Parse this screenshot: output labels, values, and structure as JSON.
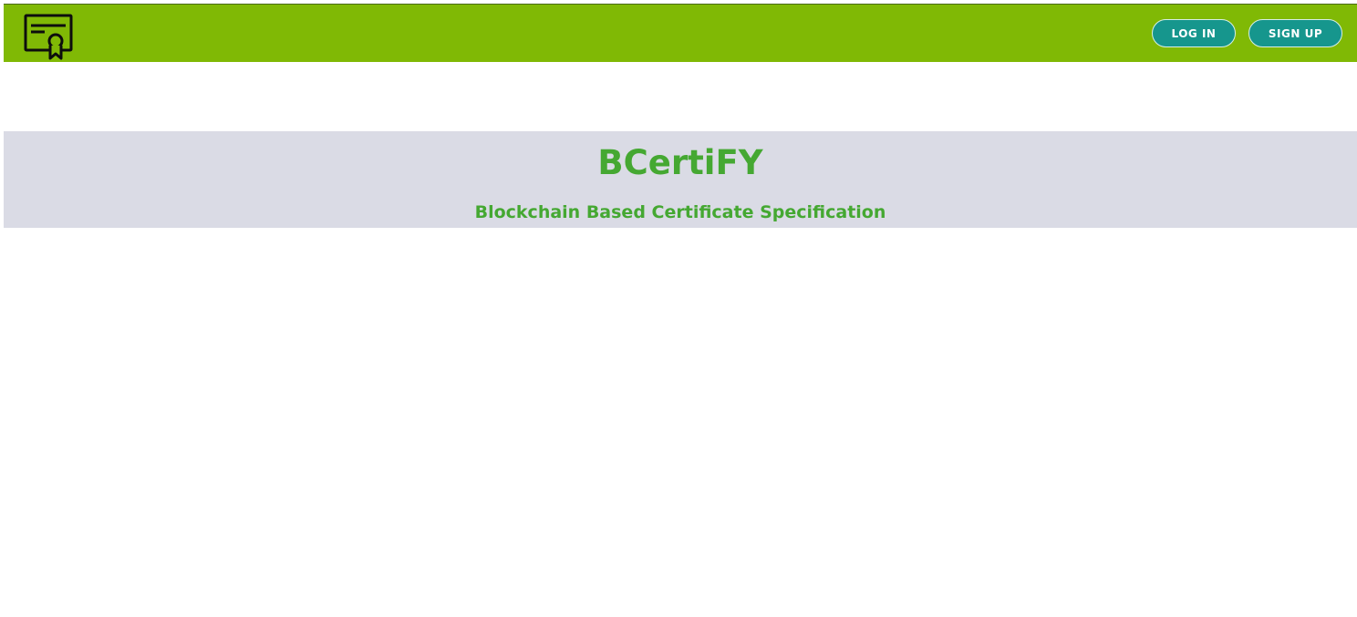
{
  "header": {
    "logo_icon": "certificate-icon",
    "login_label": "LOG IN",
    "signup_label": "SIGN UP"
  },
  "hero": {
    "title": "BCertiFY",
    "subtitle": "Blockchain Based Certificate Specification"
  },
  "colors": {
    "header_bg": "#80b905",
    "button_bg": "#16968d",
    "hero_bg": "#dadbe5",
    "hero_text": "#45a832"
  }
}
